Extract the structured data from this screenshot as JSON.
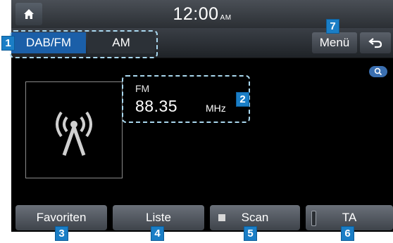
{
  "status_bar": {
    "time": "12:00",
    "ampm": "AM",
    "home_icon": "home-icon"
  },
  "toolbar": {
    "tabs": [
      {
        "label": "DAB/FM",
        "active": true
      },
      {
        "label": "AM",
        "active": false
      }
    ],
    "menu_label": "Menü",
    "back_icon": "back-arrow-icon"
  },
  "tuner": {
    "band": "FM",
    "frequency": "88.35",
    "unit": "MHz",
    "station_icon": "broadcast-antenna-icon",
    "search_icon": "search-icon"
  },
  "softkeys": [
    {
      "label": "Favoriten"
    },
    {
      "label": "Liste"
    },
    {
      "label": "Scan",
      "indicator": "stop-square-icon"
    },
    {
      "label": "TA",
      "indicator": "toggle-bar-icon"
    }
  ],
  "callouts": [
    "1",
    "2",
    "3",
    "4",
    "5",
    "6",
    "7"
  ],
  "colors": {
    "accent_blue": "#1b5fa8",
    "badge_blue": "#1a7ec6",
    "callout_outline": "#a9d7ee"
  }
}
